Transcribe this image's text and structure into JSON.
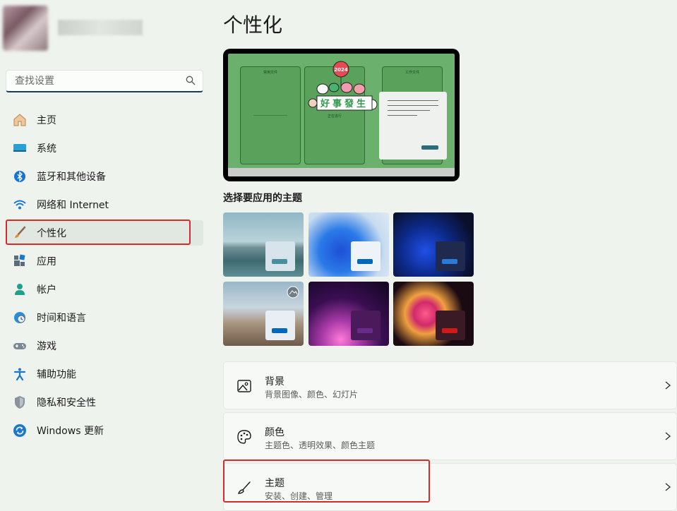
{
  "search": {
    "placeholder": "查找设置"
  },
  "nav": [
    {
      "label": "主页",
      "icon": "home-icon"
    },
    {
      "label": "系统",
      "icon": "system-icon"
    },
    {
      "label": "蓝牙和其他设备",
      "icon": "bluetooth-icon"
    },
    {
      "label": "网络和 Internet",
      "icon": "wifi-icon"
    },
    {
      "label": "个性化",
      "icon": "brush-icon",
      "active": true
    },
    {
      "label": "应用",
      "icon": "apps-icon"
    },
    {
      "label": "帐户",
      "icon": "account-icon"
    },
    {
      "label": "时间和语言",
      "icon": "globe-clock-icon"
    },
    {
      "label": "游戏",
      "icon": "gamepad-icon"
    },
    {
      "label": "辅助功能",
      "icon": "accessibility-icon"
    },
    {
      "label": "隐私和安全性",
      "icon": "shield-icon"
    },
    {
      "label": "Windows 更新",
      "icon": "update-icon"
    }
  ],
  "page": {
    "title": "个性化"
  },
  "preview": {
    "wallpaper_text": "好事發生",
    "year": "2024",
    "col1_title": "常用文件",
    "col3_title": "工作文件",
    "center_text": "正在进行"
  },
  "themes": {
    "label": "选择要应用的主题"
  },
  "cards": [
    {
      "title": "背景",
      "subtitle": "背景图像、颜色、幻灯片",
      "icon": "image-icon"
    },
    {
      "title": "颜色",
      "subtitle": "主题色、透明效果、颜色主题",
      "icon": "palette-icon"
    },
    {
      "title": "主题",
      "subtitle": "安装、创建、管理",
      "icon": "brush-icon"
    }
  ],
  "colors": {
    "accent": "#0067c0",
    "highlight": "#d82a2a"
  }
}
